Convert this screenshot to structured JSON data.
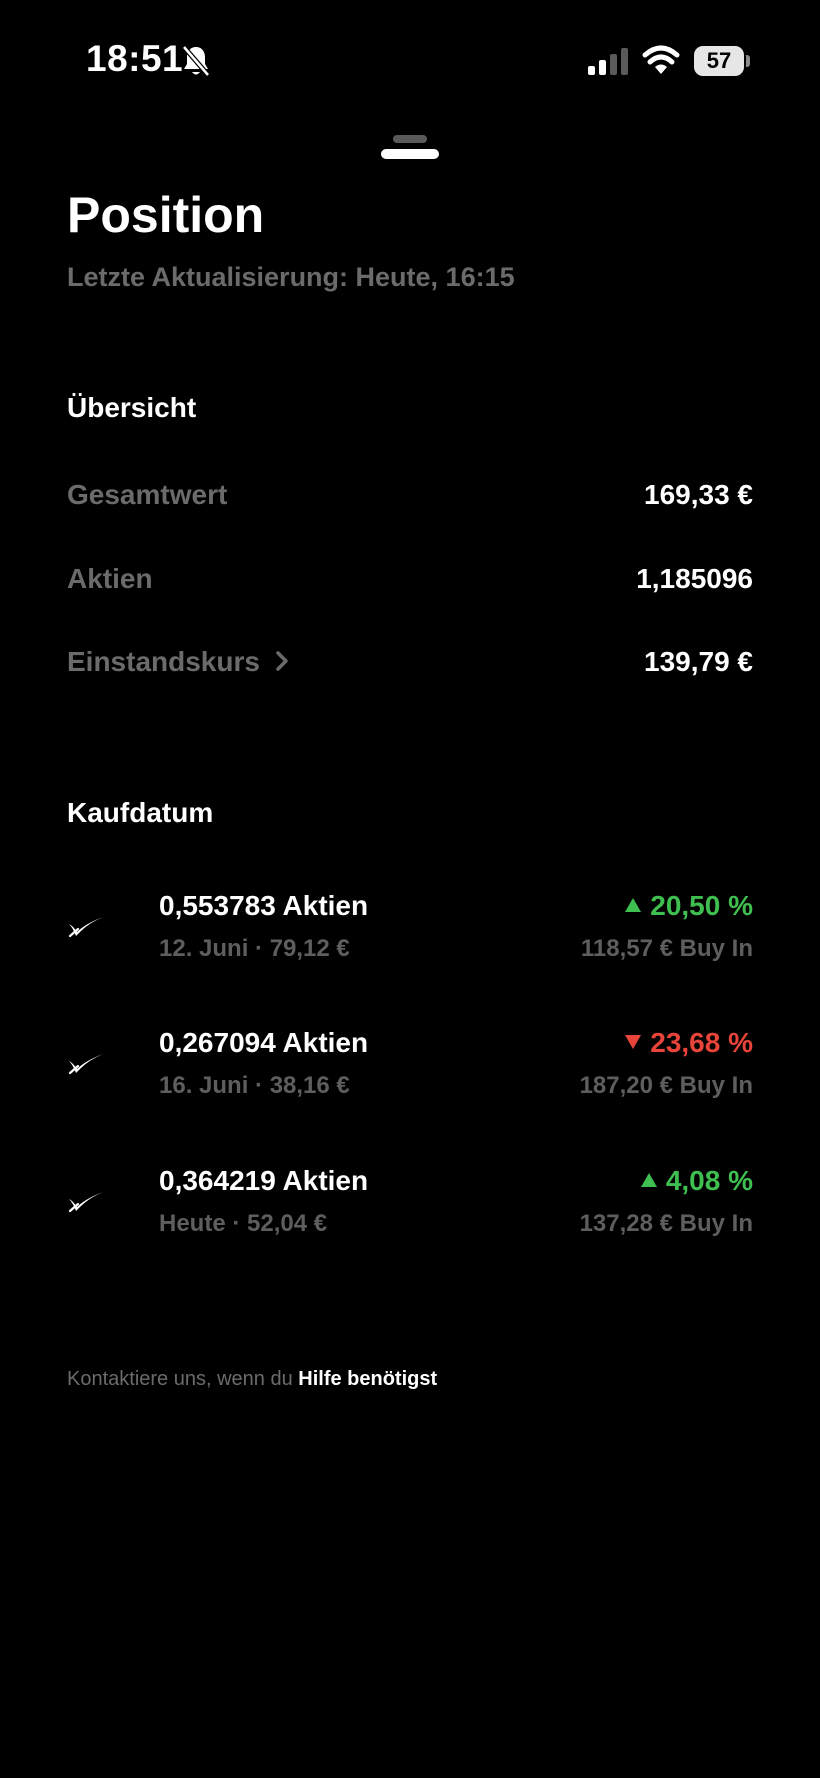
{
  "status_bar": {
    "time": "18:51",
    "battery": "57"
  },
  "header": {
    "title": "Position",
    "last_update": "Letzte Aktualisierung: Heute, 16:15"
  },
  "overview": {
    "section_title": "Übersicht",
    "rows": [
      {
        "label": "Gesamtwert",
        "value": "169,33 €"
      },
      {
        "label": "Aktien",
        "value": "1,185096"
      },
      {
        "label": "Einstandskurs",
        "value": "139,79 €"
      }
    ]
  },
  "purchases": {
    "section_title": "Kaufdatum",
    "items": [
      {
        "shares": "0,553783 Aktien",
        "subtitle": "12. Juni · 79,12 €",
        "change": "20,50 %",
        "direction": "up",
        "buy_in": "118,57 € Buy In"
      },
      {
        "shares": "0,267094 Aktien",
        "subtitle": "16. Juni · 38,16 €",
        "change": "23,68 %",
        "direction": "down",
        "buy_in": "187,20 € Buy In"
      },
      {
        "shares": "0,364219 Aktien",
        "subtitle": "Heute · 52,04 €",
        "change": "4,08 %",
        "direction": "up",
        "buy_in": "137,28 € Buy In"
      }
    ]
  },
  "footer": {
    "text": "Kontaktiere uns, wenn du ",
    "link": "Hilfe benötigst"
  },
  "colors": {
    "background": "#000000",
    "positive": "#3fbf4f",
    "negative": "#e8443a",
    "muted": "#6b6b6b"
  },
  "icons": [
    "bell-slash-icon",
    "cellular-signal-icon",
    "wifi-icon",
    "battery-icon",
    "chevron-right-icon",
    "x-logo-icon",
    "triangle-up-icon",
    "triangle-down-icon"
  ]
}
